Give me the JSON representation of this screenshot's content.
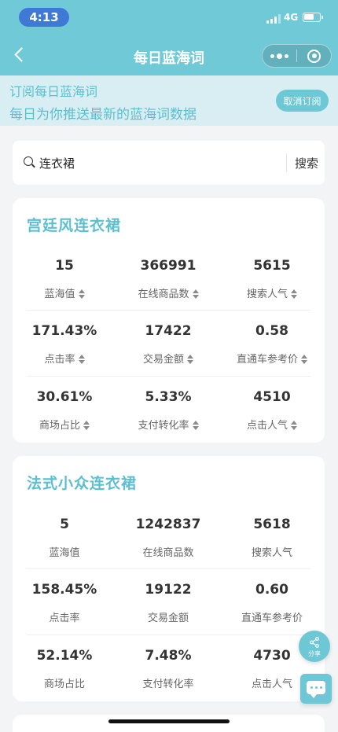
{
  "status_bar": {
    "time": "4:13",
    "network": "4G"
  },
  "nav": {
    "title": "每日蓝海词"
  },
  "subscription": {
    "line1": "订阅每日蓝海词",
    "line2": "每日为你推送最新的蓝海词数据",
    "unsubscribe_label": "取消订阅"
  },
  "search": {
    "value": "连衣裙",
    "button_label": "搜索"
  },
  "words": [
    {
      "title": "宫廷风连衣裙",
      "metrics": [
        {
          "value": "15",
          "label": "蓝海值"
        },
        {
          "value": "366991",
          "label": "在线商品数"
        },
        {
          "value": "5615",
          "label": "搜索人气"
        },
        {
          "value": "171.43%",
          "label": "点击率"
        },
        {
          "value": "17422",
          "label": "交易金额"
        },
        {
          "value": "0.58",
          "label": "直通车参考价"
        },
        {
          "value": "30.61%",
          "label": "商场占比"
        },
        {
          "value": "5.33%",
          "label": "支付转化率"
        },
        {
          "value": "4510",
          "label": "点击人气"
        }
      ]
    },
    {
      "title": "法式小众连衣裙",
      "metrics": [
        {
          "value": "5",
          "label": "蓝海值"
        },
        {
          "value": "1242837",
          "label": "在线商品数"
        },
        {
          "value": "5618",
          "label": "搜索人气"
        },
        {
          "value": "158.45%",
          "label": "点击率"
        },
        {
          "value": "19122",
          "label": "交易金额"
        },
        {
          "value": "0.60",
          "label": "直通车参考价"
        },
        {
          "value": "52.14%",
          "label": "商场占比"
        },
        {
          "value": "7.48%",
          "label": "支付转化率"
        },
        {
          "value": "4730",
          "label": "点击人气"
        }
      ]
    }
  ],
  "share": {
    "label": "分享"
  }
}
